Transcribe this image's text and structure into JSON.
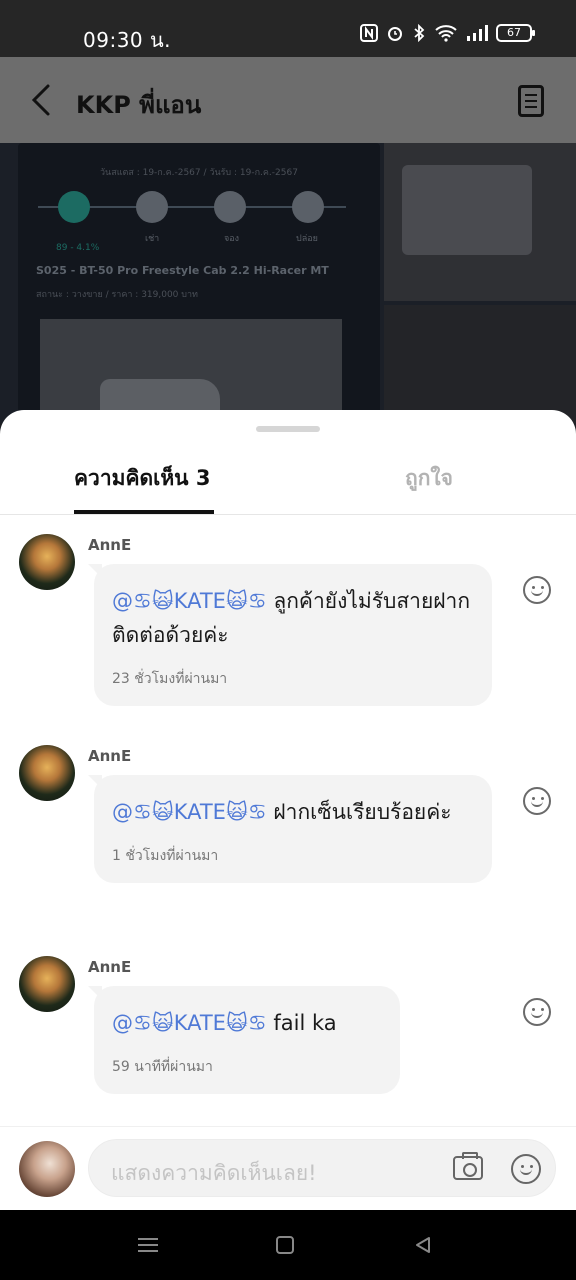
{
  "status_bar": {
    "time": "09:30 น.",
    "battery": "67"
  },
  "header": {
    "title": "KKP พี่แอน"
  },
  "backdrop": {
    "date_line": "วันสแตส : 19-ก.ค.-2567 / วันรับ : 19-ก.ค.-2567",
    "progress": "89 - 4.1%",
    "steps": [
      "เช่า",
      "จอง",
      "ปล่อย"
    ],
    "car_title": "S025 - BT-50 Pro Freestyle Cab 2.2 Hi-Racer MT",
    "car_status": "สถานะ : วางขาย / ราคา : 319,000 บาท"
  },
  "sheet": {
    "tab_comments": "ความคิดเห็น 3",
    "tab_likes": "ถูกใจ"
  },
  "comments": [
    {
      "author": "AnnE",
      "mention": "@♋🙀KATE🙀♋",
      "text": " ลูกค้ายังไม่รับสายฝากติดต่อด้วยค่ะ",
      "time": "23 ชั่วโมงที่ผ่านมา"
    },
    {
      "author": "AnnE",
      "mention": "@♋🙀KATE🙀♋",
      "text": " ฝากเซ็นเรียบร้อยค่ะ",
      "time": "1 ชั่วโมงที่ผ่านมา"
    },
    {
      "author": "AnnE",
      "mention": "@♋🙀KATE🙀♋",
      "text": " fail ka",
      "time": "59 นาทีที่ผ่านมา"
    }
  ],
  "input": {
    "placeholder": "แสดงความคิดเห็นเลย!"
  },
  "icons": {
    "back": "back-arrow-icon",
    "document": "document-icon",
    "camera": "camera-icon",
    "emoji": "smiley-icon"
  }
}
